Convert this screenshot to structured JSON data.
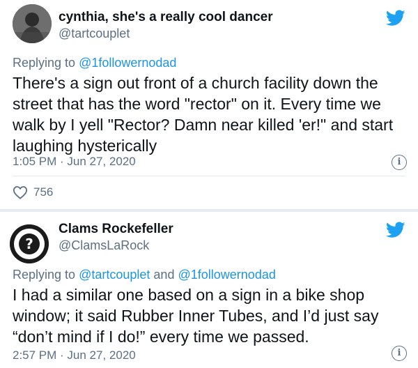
{
  "tweets": [
    {
      "display_name": "cynthia, she's a really cool dancer",
      "handle": "@tartcouplet",
      "reply_prefix": "Replying to",
      "reply_to": "@1followernodad",
      "text": "There's a sign out front of a church facility down the street that has the word \"rector\" on it. Every time we walk by I yell \"Rector? Damn near killed 'er!\" and start laughing hysterically",
      "timestamp": "1:05 PM · Jun 27, 2020",
      "likes": "756",
      "icon": "twitter-bird-icon"
    },
    {
      "display_name": "Clams Rockefeller",
      "handle": "@ClamsLaRock",
      "reply_prefix": "Replying to",
      "reply_to_1": "@tartcouplet",
      "reply_and": "and",
      "reply_to_2": "@1followernodad",
      "text": "I had a similar one based on a sign in a bike shop window; it said Rubber Inner Tubes, and I’d just say “don’t mind if I do!” every time we passed.",
      "timestamp": "2:57 PM · Jun 27, 2020",
      "icon": "twitter-bird-icon"
    }
  ],
  "colors": {
    "bird": "#1da1f2",
    "link": "#1b95e0",
    "muted": "#5b7083",
    "separator": "#e6ecf0"
  }
}
